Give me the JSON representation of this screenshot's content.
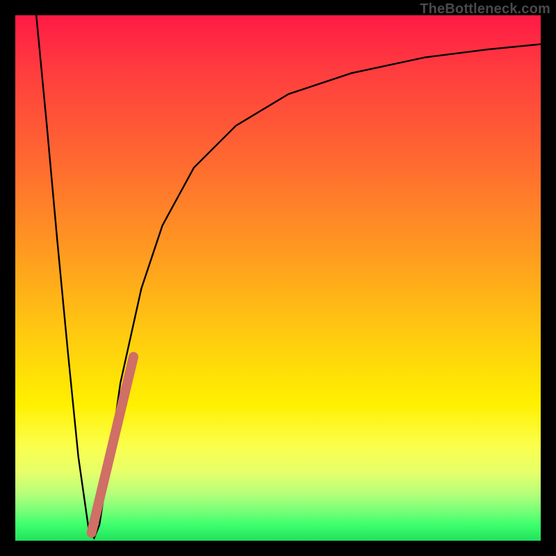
{
  "watermark": "TheBottleneck.com",
  "colors": {
    "curve": "#000000",
    "marker": "#cf6f65",
    "frame": "#000000"
  },
  "chart_data": {
    "type": "line",
    "title": "",
    "xlabel": "",
    "ylabel": "",
    "xlim": [
      0,
      100
    ],
    "ylim": [
      0,
      100
    ],
    "grid": false,
    "legend": false,
    "series": [
      {
        "name": "bottleneck-curve",
        "x": [
          4,
          6,
          8,
          10,
          12,
          14,
          15,
          16,
          18,
          20,
          24,
          28,
          34,
          42,
          52,
          64,
          78,
          90,
          100
        ],
        "y": [
          100,
          79,
          57,
          36,
          16,
          2,
          0.5,
          3,
          16,
          30,
          48,
          60,
          71,
          79,
          85,
          89,
          92,
          93.5,
          94.5
        ]
      }
    ],
    "annotations": [
      {
        "name": "highlight-segment",
        "shape": "thick-line",
        "color": "#cf6f65",
        "points_xy": [
          [
            14.5,
            1.5
          ],
          [
            22.5,
            35
          ]
        ]
      }
    ],
    "minimum_x": 15
  }
}
